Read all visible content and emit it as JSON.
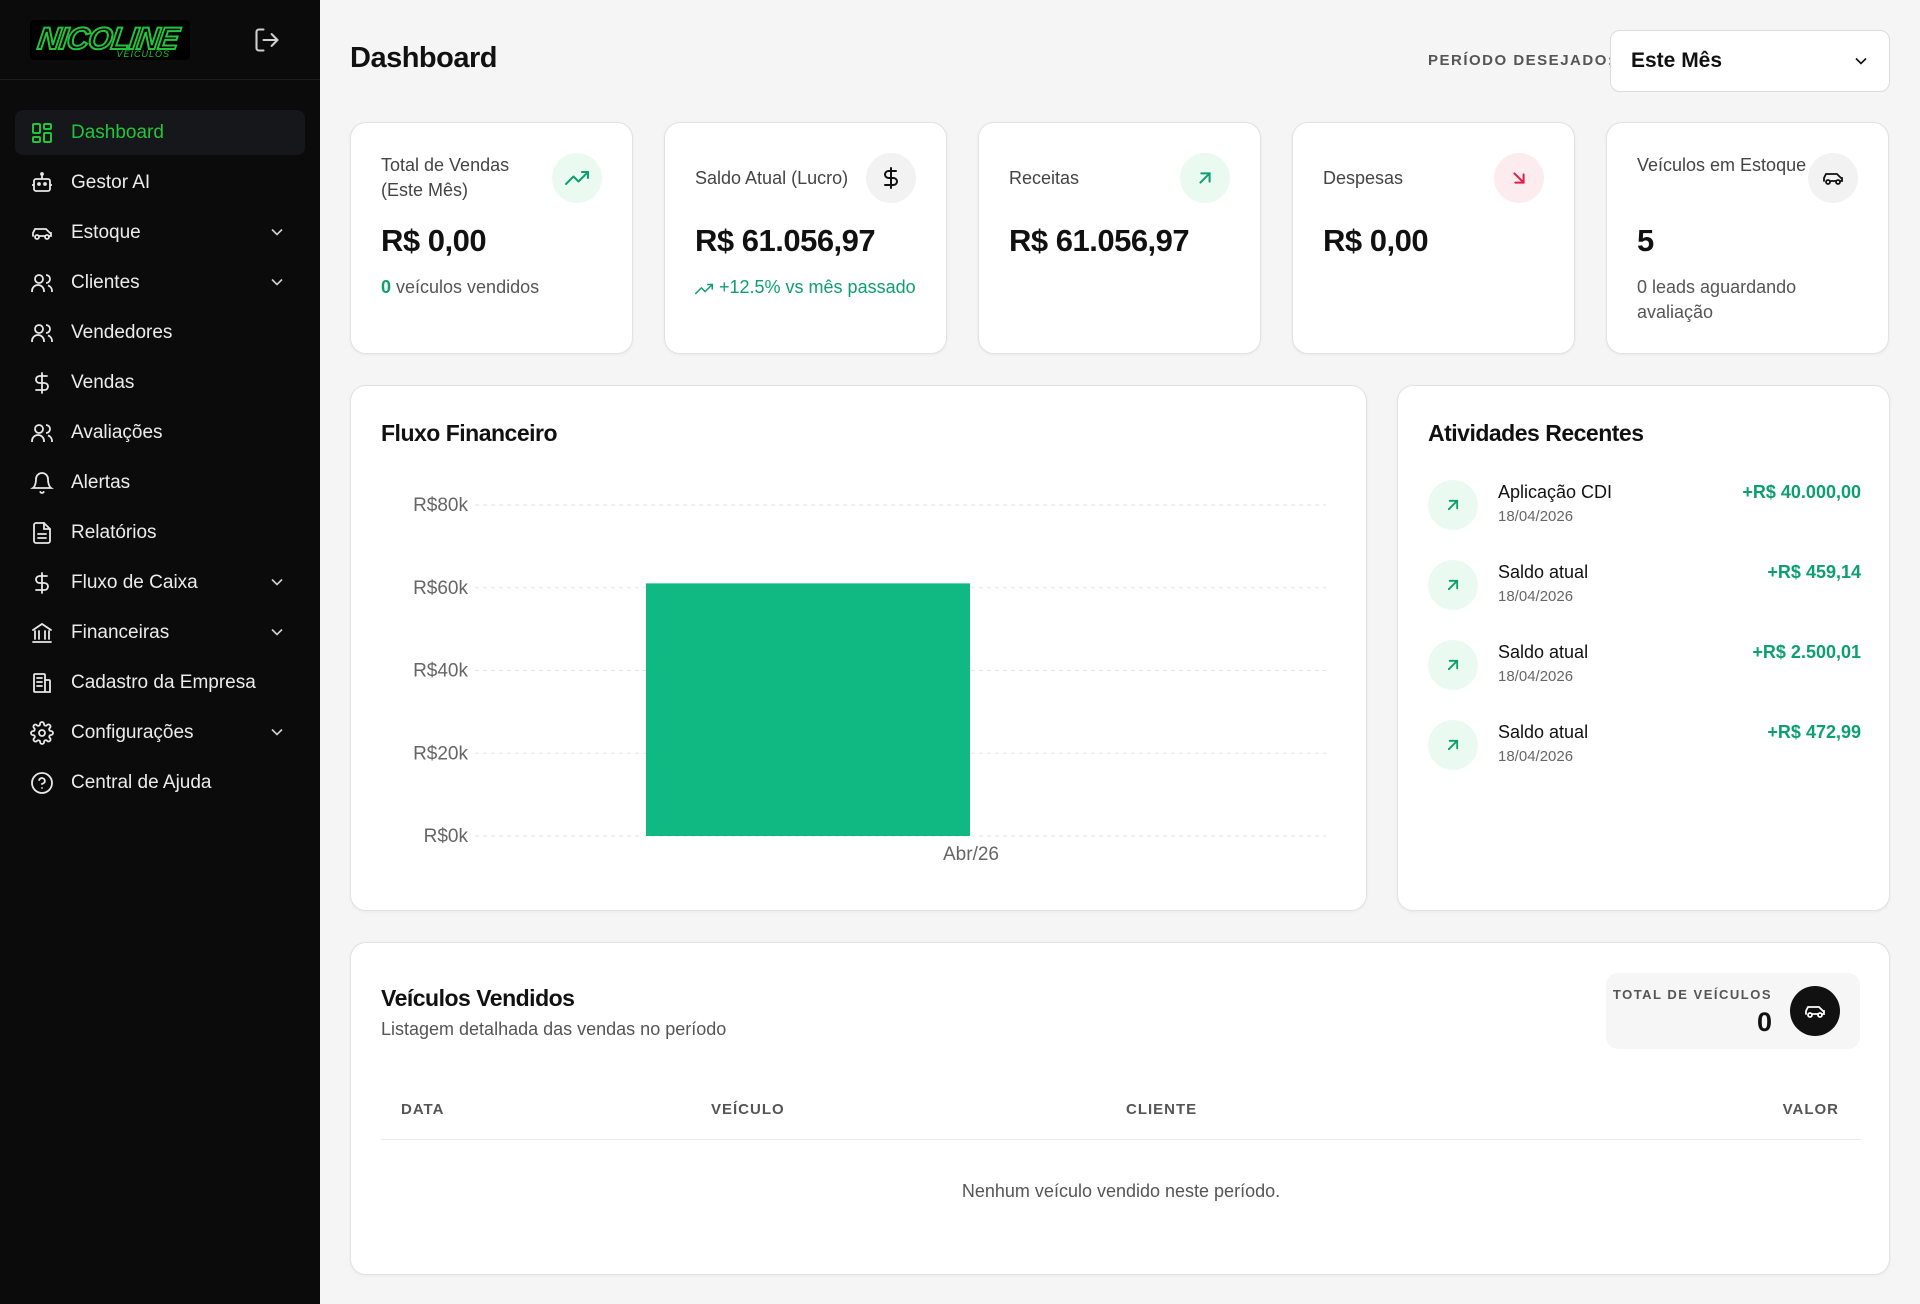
{
  "app": {
    "logo_text": "NICOLINE",
    "logo_sub": "VEÍCULOS"
  },
  "sidebar": {
    "items": [
      {
        "label": "Dashboard",
        "icon": "dashboard-grid-icon",
        "active": true,
        "expandable": false
      },
      {
        "label": "Gestor AI",
        "icon": "robot-icon",
        "active": false,
        "expandable": false
      },
      {
        "label": "Estoque",
        "icon": "car-icon",
        "active": false,
        "expandable": true
      },
      {
        "label": "Clientes",
        "icon": "users-icon",
        "active": false,
        "expandable": true
      },
      {
        "label": "Vendedores",
        "icon": "users-icon",
        "active": false,
        "expandable": false
      },
      {
        "label": "Vendas",
        "icon": "dollar-icon",
        "active": false,
        "expandable": false
      },
      {
        "label": "Avaliações",
        "icon": "users-icon",
        "active": false,
        "expandable": false
      },
      {
        "label": "Alertas",
        "icon": "bell-icon",
        "active": false,
        "expandable": false
      },
      {
        "label": "Relatórios",
        "icon": "file-icon",
        "active": false,
        "expandable": false
      },
      {
        "label": "Fluxo de Caixa",
        "icon": "dollar-icon",
        "active": false,
        "expandable": true
      },
      {
        "label": "Financeiras",
        "icon": "bank-icon",
        "active": false,
        "expandable": true
      },
      {
        "label": "Cadastro da Empresa",
        "icon": "building-icon",
        "active": false,
        "expandable": false
      },
      {
        "label": "Configurações",
        "icon": "gear-icon",
        "active": false,
        "expandable": true
      },
      {
        "label": "Central de Ajuda",
        "icon": "help-icon",
        "active": false,
        "expandable": false
      }
    ]
  },
  "header": {
    "title": "Dashboard",
    "period_label": "PERÍODO DESEJADO:",
    "period_value": "Este Mês"
  },
  "stats": [
    {
      "label": "Total de Vendas (Este Mês)",
      "value": "R$ 0,00",
      "sub_count": "0",
      "sub_text": " veículos vendidos",
      "icon": "trending-up-icon"
    },
    {
      "label": "Saldo Atual (Lucro)",
      "value": "R$ 61.056,97",
      "sub_text": "+12.5% vs mês passado",
      "icon": "dollar-icon"
    },
    {
      "label": "Receitas",
      "value": "R$ 61.056,97",
      "icon": "arrow-up-right-icon"
    },
    {
      "label": "Despesas",
      "value": "R$ 0,00",
      "icon": "arrow-down-right-icon"
    },
    {
      "label": "Veículos em Estoque",
      "value": "5",
      "sub_text": "0 leads aguardando avaliação",
      "icon": "car-icon"
    }
  ],
  "chart": {
    "title": "Fluxo Financeiro"
  },
  "chart_data": {
    "type": "bar",
    "title": "Fluxo Financeiro",
    "categories": [
      "Abr/26"
    ],
    "values": [
      61056.97
    ],
    "ylim": [
      0,
      80000
    ],
    "yticks": [
      0,
      20000,
      40000,
      60000,
      80000
    ],
    "ytick_labels": [
      "R$0k",
      "R$20k",
      "R$40k",
      "R$60k",
      "R$80k"
    ],
    "xlabel": "",
    "ylabel": "",
    "grid": true,
    "bar_color": "#10b981"
  },
  "activity": {
    "title": "Atividades Recentes",
    "items": [
      {
        "name": "Aplicação CDI",
        "date": "18/04/2026",
        "amount": "+R$ 40.000,00"
      },
      {
        "name": "Saldo atual",
        "date": "18/04/2026",
        "amount": "+R$ 459,14"
      },
      {
        "name": "Saldo atual",
        "date": "18/04/2026",
        "amount": "+R$ 2.500,01"
      },
      {
        "name": "Saldo atual",
        "date": "18/04/2026",
        "amount": "+R$ 472,99"
      }
    ]
  },
  "sold": {
    "title": "Veículos Vendidos",
    "subtitle": "Listagem detalhada das vendas no período",
    "total_label": "TOTAL DE VEÍCULOS",
    "total_value": "0",
    "columns": [
      "DATA",
      "VEÍCULO",
      "CLIENTE",
      "VALOR"
    ],
    "empty_message": "Nenhum veículo vendido neste período."
  },
  "colors": {
    "accent": "#22c53a",
    "positive": "#0e9f6e",
    "negative": "#e11d48",
    "sidebar_bg": "#0b0b0c"
  }
}
